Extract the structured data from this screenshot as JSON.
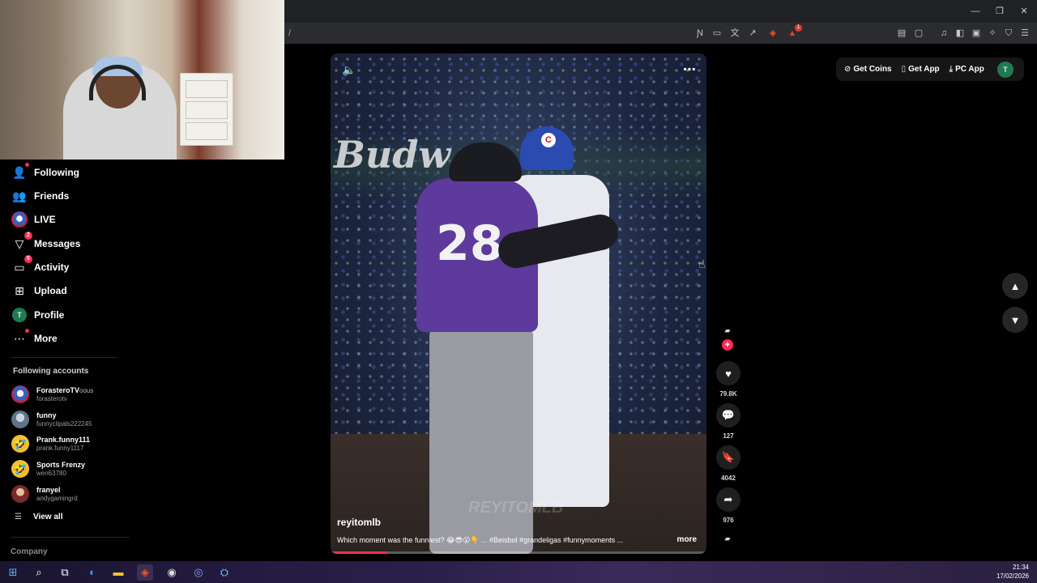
{
  "browser": {
    "url": "/",
    "window_controls": {
      "minimize": "—",
      "restore": "❐",
      "close": "✕"
    },
    "toolbar_badge": "1"
  },
  "sidebar": {
    "items": [
      {
        "label": "Following",
        "icon": "person-check-icon"
      },
      {
        "label": "Friends",
        "icon": "friends-icon"
      },
      {
        "label": "LIVE",
        "icon": "live-icon"
      },
      {
        "label": "Messages",
        "icon": "send-icon",
        "badge": "2"
      },
      {
        "label": "Activity",
        "icon": "bell-icon",
        "badge": "5"
      },
      {
        "label": "Upload",
        "icon": "plus-box-icon"
      },
      {
        "label": "Profile",
        "icon": "avatar",
        "avatar_letter": "T"
      },
      {
        "label": "More",
        "icon": "ellipsis-icon"
      }
    ],
    "following_title": "Following accounts",
    "accounts": [
      {
        "name": "ForasteroTV",
        "suffix": "oous",
        "handle": "forasterotv",
        "color": "#3b5fbf"
      },
      {
        "name": "funny",
        "handle": "funnyclipals222245",
        "color": "#7a8fa6"
      },
      {
        "name": "Prank.funny111",
        "handle": "prank.funny1117",
        "color": "#f2c230"
      },
      {
        "name": "Sports Frenzy",
        "handle": "wen63780",
        "color": "#f2c230"
      },
      {
        "name": "franyel",
        "handle": "andygamingrd",
        "color": "#b03a3a"
      }
    ],
    "view_all": "View all",
    "company": "Company"
  },
  "video": {
    "watermark": "REYITOMLB",
    "jersey_number": "28",
    "brand_text": "Budw",
    "author": "reyitomlb",
    "caption": "Which moment was the funniest? 😂😎😮👇 ... #Beisbol #grandeligas #funnymoments ...",
    "more": "more",
    "progress": 0.15
  },
  "actions": {
    "likes": "79.8K",
    "comments": "127",
    "saves": "4042",
    "shares": "976"
  },
  "top_actions": {
    "get_coins": "Get Coins",
    "get_app": "Get App",
    "pc_app": "PC App",
    "avatar_letter": "T"
  },
  "taskbar": {
    "time": "21:34",
    "date": "17/02/2026"
  },
  "colors": {
    "accent": "#fe2c55",
    "avatar_green": "#1f7a52"
  }
}
